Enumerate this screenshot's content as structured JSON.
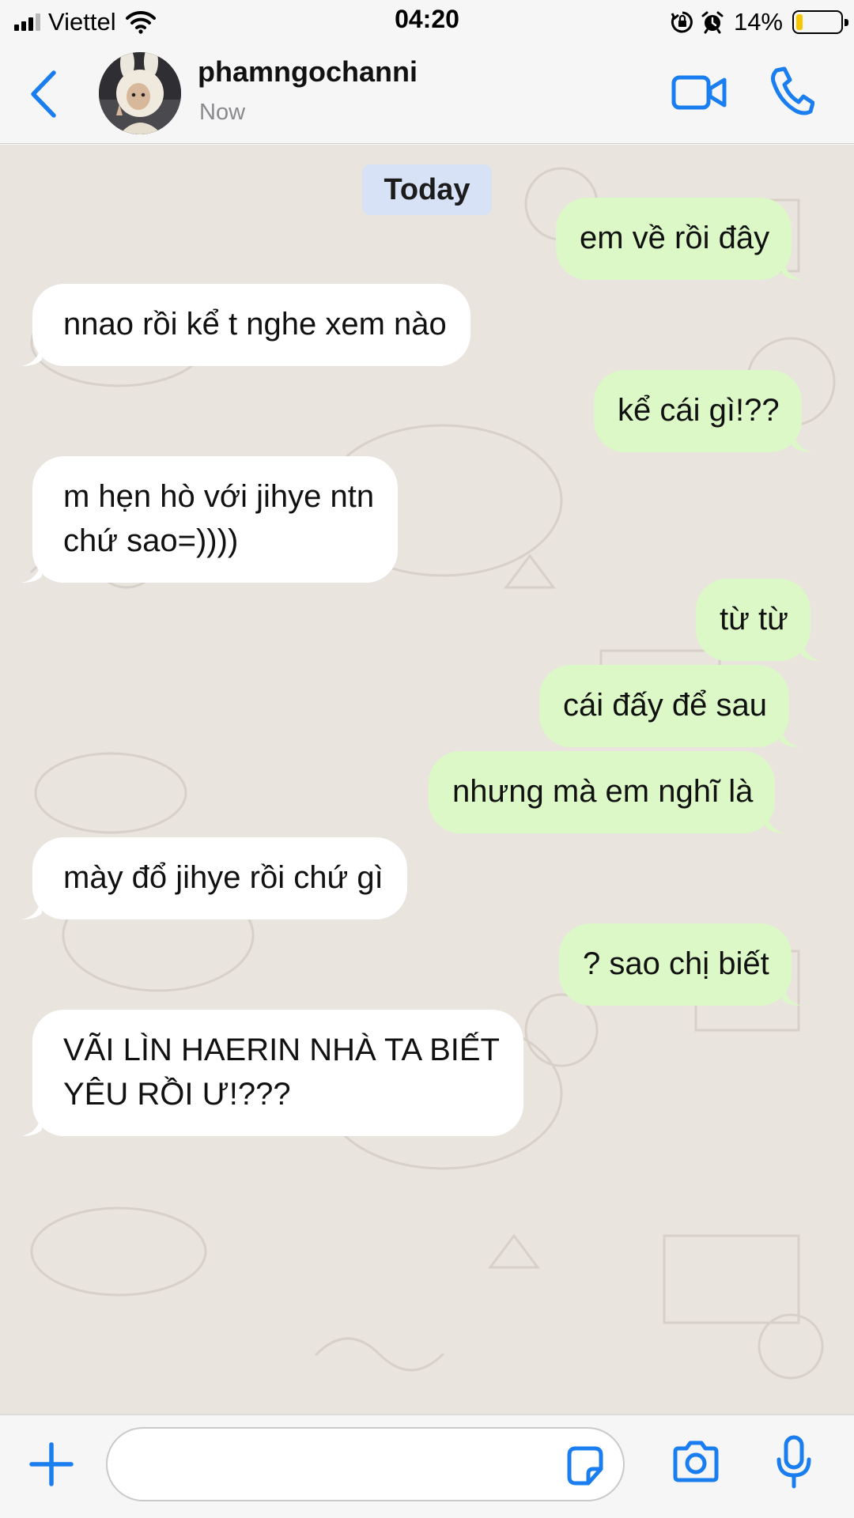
{
  "status_bar": {
    "carrier": "Viettel",
    "time": "04:20",
    "battery_percent": "14%",
    "battery_level": 0.14,
    "icons": [
      "signal-icon",
      "wifi-icon",
      "rotation-lock-icon",
      "alarm-icon",
      "battery-icon"
    ]
  },
  "header": {
    "back_icon": "chevron-left-icon",
    "contact_name": "phamngochanni",
    "contact_status": "Now",
    "video_icon": "video-camera-icon",
    "call_icon": "phone-icon"
  },
  "chat": {
    "date_label": "Today",
    "messages": [
      {
        "dir": "out",
        "text": "em về rồi đây"
      },
      {
        "dir": "in",
        "text": "nnao rồi kể t nghe xem nào"
      },
      {
        "dir": "out",
        "text": "kể cái gì!??"
      },
      {
        "dir": "in",
        "text": "m hẹn hò với jihye ntn\nchứ sao=))))"
      },
      {
        "dir": "out",
        "text": "từ từ"
      },
      {
        "dir": "out",
        "text": "cái đấy để sau"
      },
      {
        "dir": "out",
        "text": "nhưng mà em nghĩ là"
      },
      {
        "dir": "in",
        "text": "mày đổ jihye rồi chứ gì"
      },
      {
        "dir": "out",
        "text": "? sao chị biết"
      },
      {
        "dir": "in",
        "text": "VÃI LÌN HAERIN NHÀ TA BIẾT\nYÊU RỒI Ư!???"
      }
    ]
  },
  "input_bar": {
    "placeholder": "",
    "icons": [
      "plus-icon",
      "sticker-icon",
      "camera-icon",
      "microphone-icon"
    ]
  },
  "colors": {
    "accent": "#1a7ef0",
    "outgoing_bubble": "#dcf8c6",
    "incoming_bubble": "#ffffff",
    "date_chip": "#d8e2f6",
    "chat_background": "#e9e4de"
  }
}
